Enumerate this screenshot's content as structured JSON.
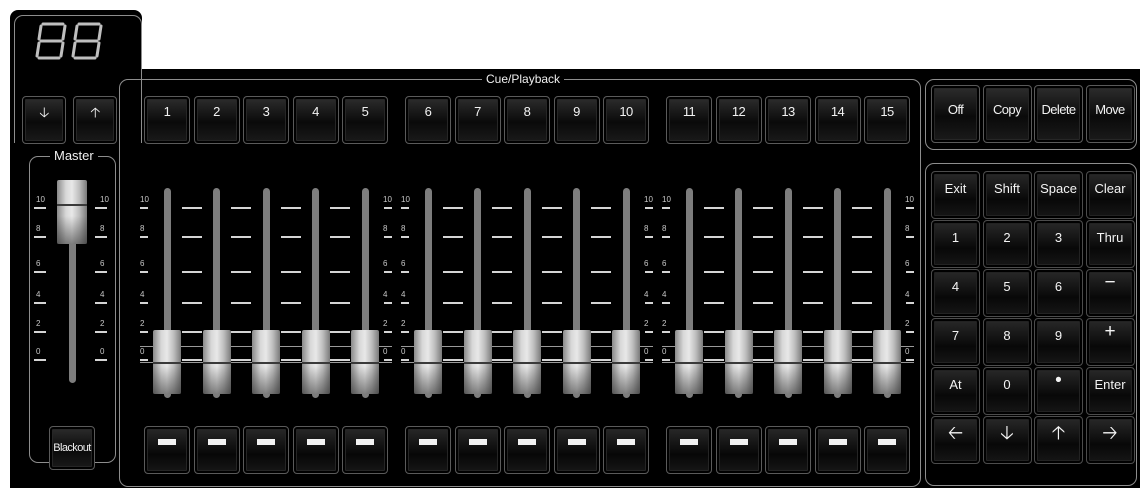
{
  "display": {
    "readout": "88"
  },
  "cue_playback": {
    "title": "Cue/Playback",
    "nav_buttons": [
      {
        "glyph": "🡣",
        "icon": "arrow-down-icon"
      },
      {
        "glyph": "🡡",
        "icon": "arrow-up-icon"
      }
    ],
    "playbacks": [
      "1",
      "2",
      "3",
      "4",
      "5",
      "6",
      "7",
      "8",
      "9",
      "10",
      "11",
      "12",
      "13",
      "14",
      "15"
    ],
    "scale_labels": [
      "10",
      "8",
      "6",
      "4",
      "2",
      "0"
    ]
  },
  "master": {
    "title": "Master",
    "scale_labels": [
      "10",
      "8",
      "6",
      "4",
      "2",
      "0"
    ],
    "level": 1.0,
    "blackout_label": "Blackout"
  },
  "fader_levels": [
    0,
    0,
    0,
    0,
    0,
    0,
    0,
    0,
    0,
    0,
    0,
    0,
    0,
    0,
    0
  ],
  "edit_buttons": [
    "Off",
    "Copy",
    "Delete",
    "Move"
  ],
  "keypad": [
    [
      "Exit",
      "Shift",
      "Space",
      "Clear"
    ],
    [
      "1",
      "2",
      "3",
      "Thru"
    ],
    [
      "4",
      "5",
      "6",
      "−"
    ],
    [
      "7",
      "8",
      "9",
      "+"
    ],
    [
      "At",
      "0",
      "•",
      "Enter"
    ],
    [
      "🡠",
      "🡣",
      "🡡",
      "🡢"
    ]
  ],
  "keypad_icons": [
    "arrow-left-icon",
    "arrow-down-icon",
    "arrow-up-icon",
    "arrow-right-icon"
  ]
}
